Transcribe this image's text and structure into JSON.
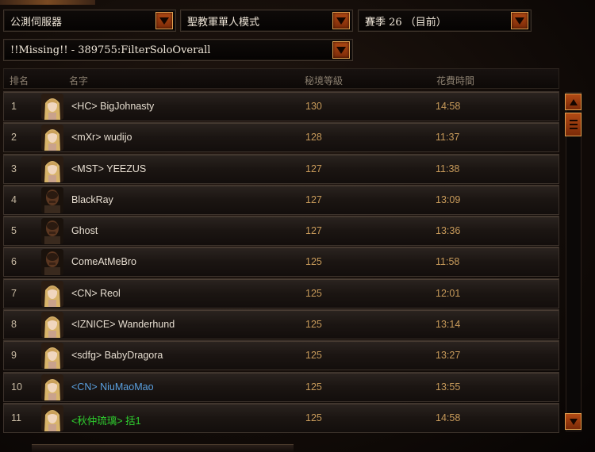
{
  "filters": {
    "server": "公測伺服器",
    "mode": "聖教軍單人模式",
    "season": "賽季 26 （目前）",
    "board": "!!Missing!! - 389755:FilterSoloOverall"
  },
  "columns": {
    "rank": "排名",
    "name": "名字",
    "level": "秘境等級",
    "time": "花費時間"
  },
  "rows": [
    {
      "rank": "1",
      "name": "<HC> BigJohnasty",
      "level": "130",
      "time": "14:58",
      "portrait": "female"
    },
    {
      "rank": "2",
      "name": "<mXr> wudijo",
      "level": "128",
      "time": "11:37",
      "portrait": "female"
    },
    {
      "rank": "3",
      "name": "<MST> YEEZUS",
      "level": "127",
      "time": "11:38",
      "portrait": "female"
    },
    {
      "rank": "4",
      "name": "BlackRay",
      "level": "127",
      "time": "13:09",
      "portrait": "male"
    },
    {
      "rank": "5",
      "name": "Ghost",
      "level": "127",
      "time": "13:36",
      "portrait": "male"
    },
    {
      "rank": "6",
      "name": "ComeAtMeBro",
      "level": "125",
      "time": "11:58",
      "portrait": "male"
    },
    {
      "rank": "7",
      "name": "<CN> Reol",
      "level": "125",
      "time": "12:01",
      "portrait": "female"
    },
    {
      "rank": "8",
      "name": "<IZNICE> Wanderhund",
      "level": "125",
      "time": "13:14",
      "portrait": "female"
    },
    {
      "rank": "9",
      "name": "<sdfg> BabyDragora",
      "level": "125",
      "time": "13:27",
      "portrait": "female"
    },
    {
      "rank": "10",
      "name": "<CN> NiuMaoMao",
      "level": "125",
      "time": "13:55",
      "portrait": "female",
      "name_color": "#5aa0e0"
    },
    {
      "rank": "11",
      "name": "<秋仲琉璃> 括1",
      "level": "125",
      "time": "14:58",
      "portrait": "female",
      "name_color": "#2fd02f"
    }
  ],
  "icons": {
    "dropdown": "chevron-down-icon",
    "scroll_up": "arrow-up-icon",
    "scroll_thumb": "grip-icon",
    "scroll_down": "arrow-down-icon"
  }
}
